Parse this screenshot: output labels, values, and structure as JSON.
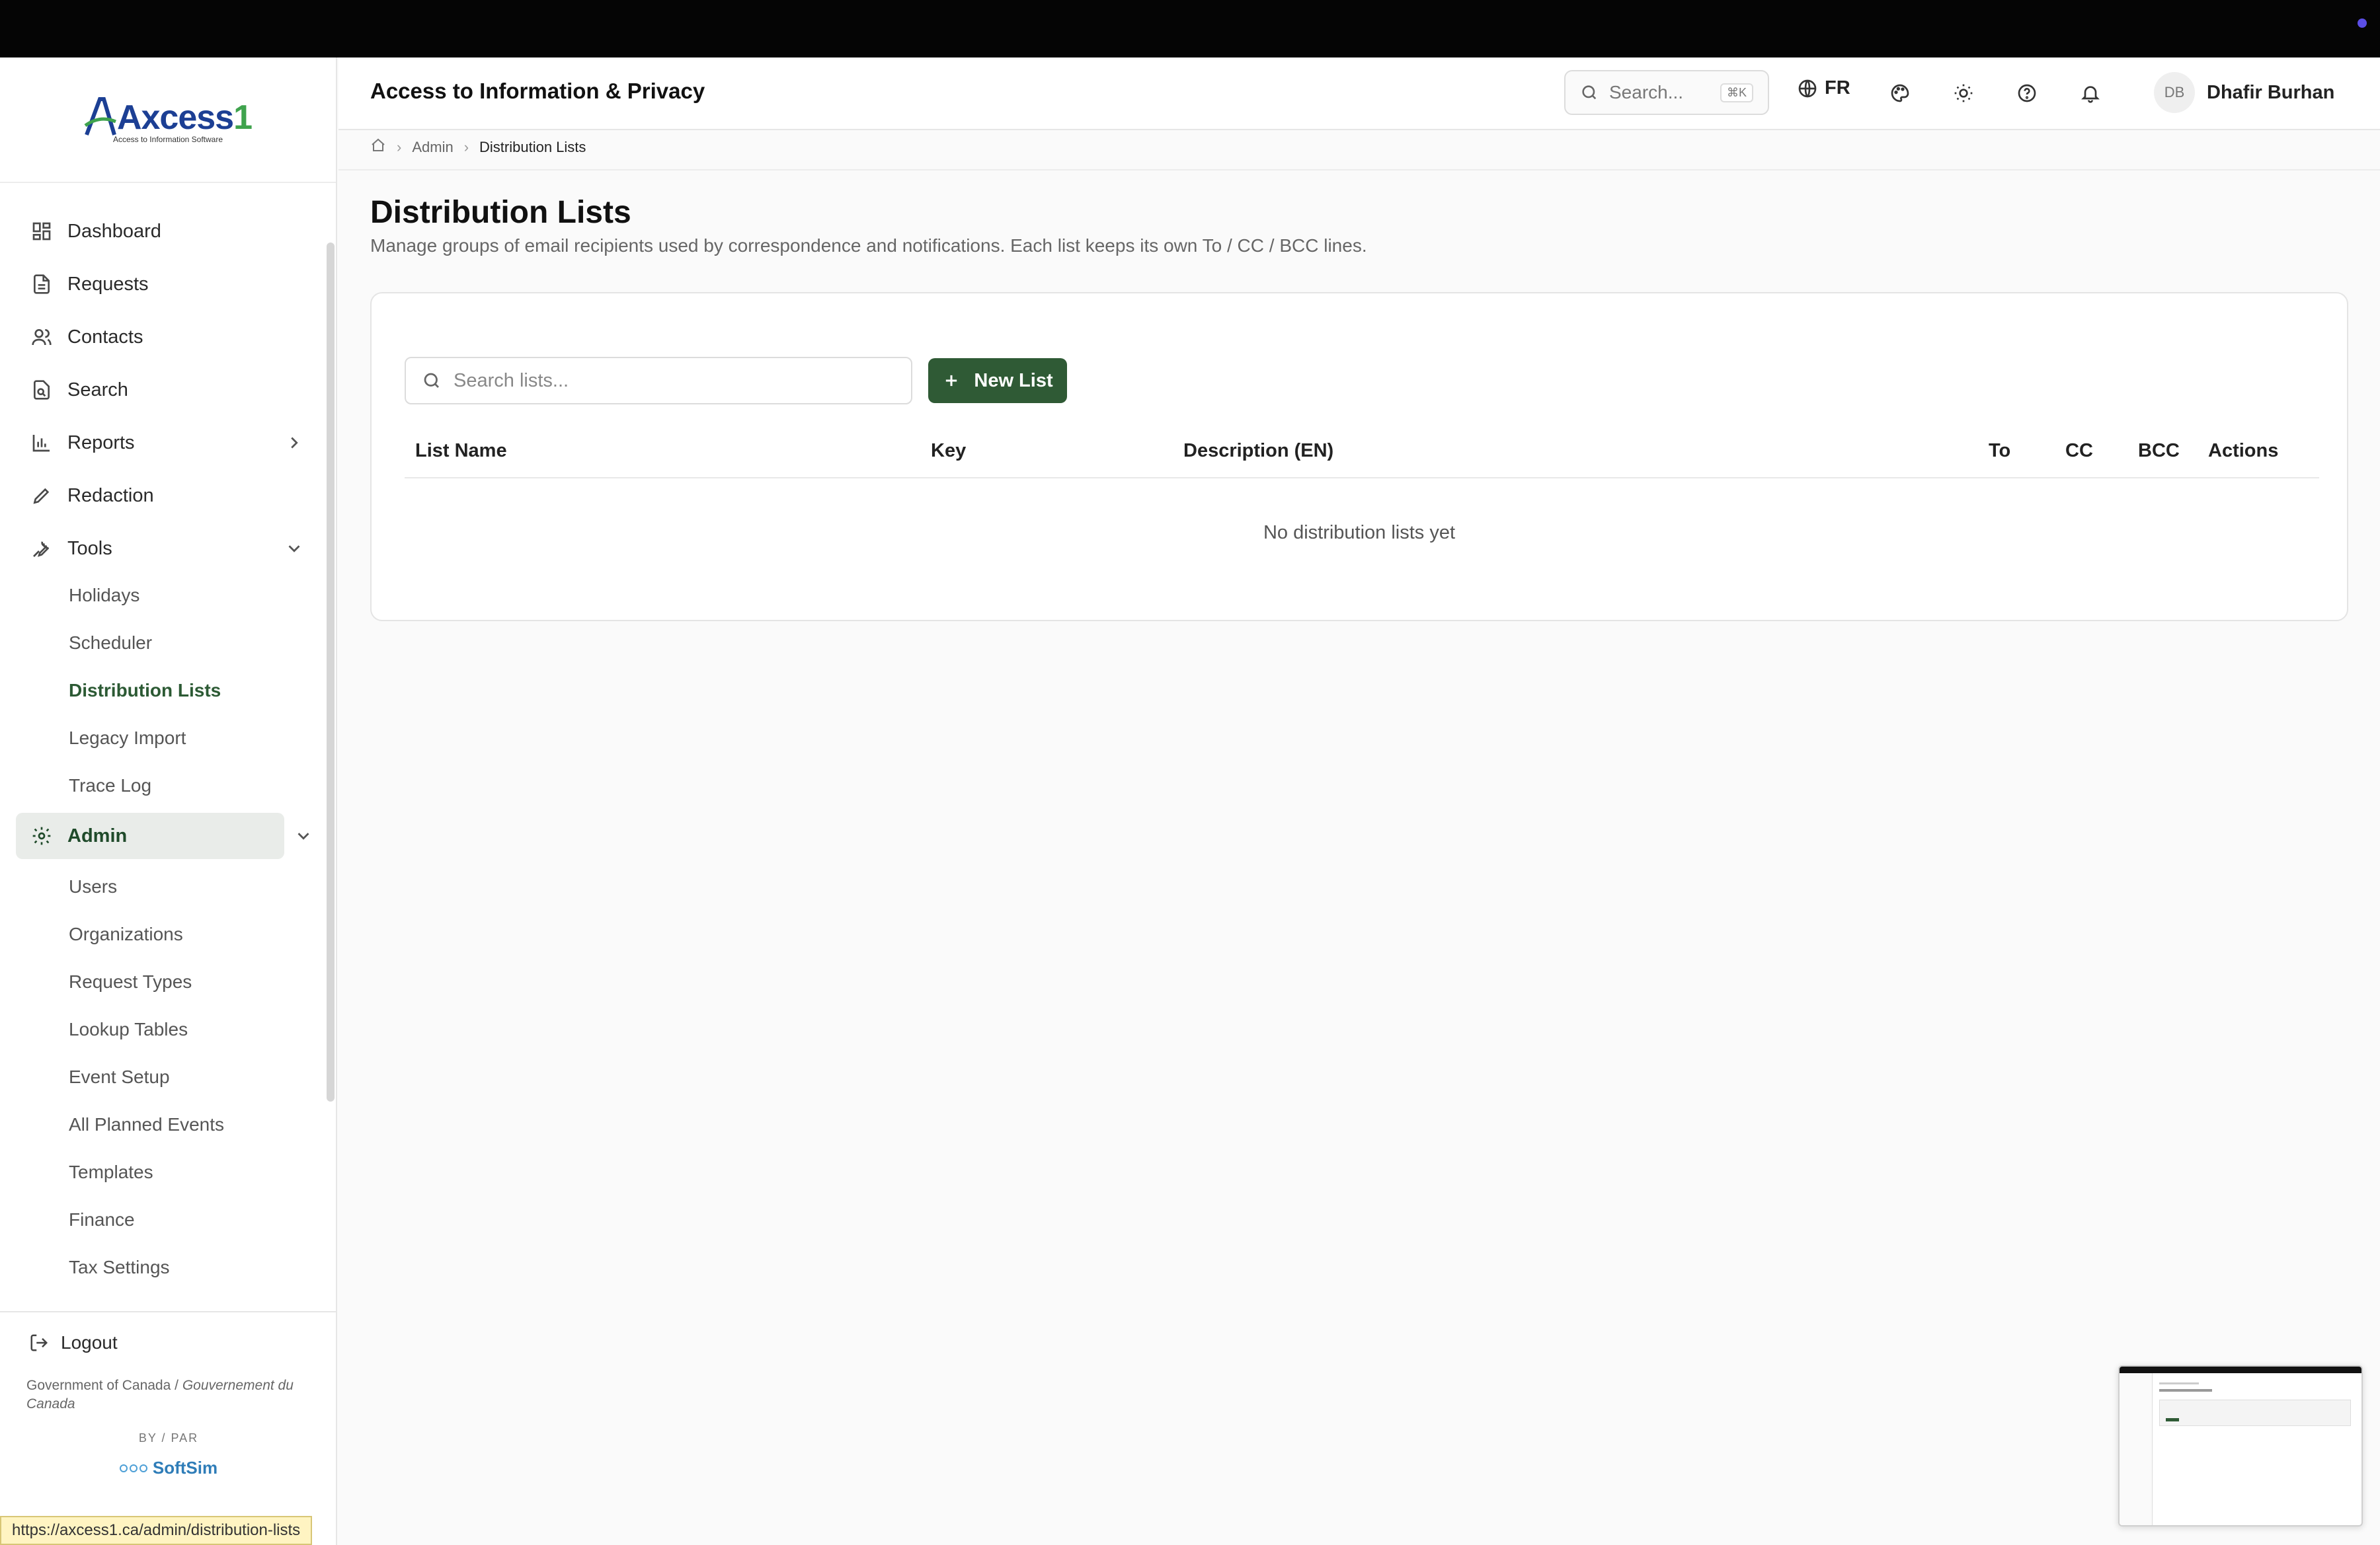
{
  "app": {
    "title": "Access to Information & Privacy",
    "logo_text": "Axcess",
    "logo_number": "1",
    "logo_tagline": "Access to Information Software"
  },
  "header": {
    "search_placeholder": "Search...",
    "search_shortcut": "⌘K",
    "language": "FR",
    "user_initials": "DB",
    "user_name": "Dhafir Burhan"
  },
  "breadcrumb": {
    "items": [
      "Admin",
      "Distribution Lists"
    ]
  },
  "sidebar": {
    "items": [
      {
        "label": "Dashboard",
        "icon": "dashboard-grid-icon"
      },
      {
        "label": "Requests",
        "icon": "file-icon"
      },
      {
        "label": "Contacts",
        "icon": "users-icon"
      },
      {
        "label": "Search",
        "icon": "file-search-icon"
      },
      {
        "label": "Reports",
        "icon": "bar-chart-icon"
      },
      {
        "label": "Redaction",
        "icon": "pen-icon"
      },
      {
        "label": "Tools",
        "icon": "wrench-icon"
      }
    ],
    "tools_sub": [
      "Holidays",
      "Scheduler",
      "Distribution Lists",
      "Legacy Import",
      "Trace Log"
    ],
    "admin_label": "Admin",
    "admin_sub": [
      "Users",
      "Organizations",
      "Request Types",
      "Lookup Tables",
      "Event Setup",
      "All Planned Events",
      "Templates",
      "Finance",
      "Tax Settings"
    ],
    "logout": "Logout",
    "gov_en": "Government of Canada",
    "gov_fr": "Gouvernement du Canada",
    "by_par": "BY / PAR",
    "vendor": "SoftSim"
  },
  "page": {
    "title": "Distribution Lists",
    "description": "Manage groups of email recipients used by correspondence and notifications. Each list keeps its own To / CC / BCC lines."
  },
  "lists": {
    "search_placeholder": "Search lists...",
    "new_button": "New List",
    "columns": [
      "List Name",
      "Key",
      "Description (EN)",
      "To",
      "CC",
      "BCC",
      "Actions"
    ],
    "rows": [],
    "empty_message": "No distribution lists yet"
  },
  "status_url": "https://axcess1.ca/admin/distribution-lists",
  "colors": {
    "brand_green": "#2f5a35",
    "active_nav_bg": "#e9ece9",
    "logo_blue": "#1c3f94"
  }
}
